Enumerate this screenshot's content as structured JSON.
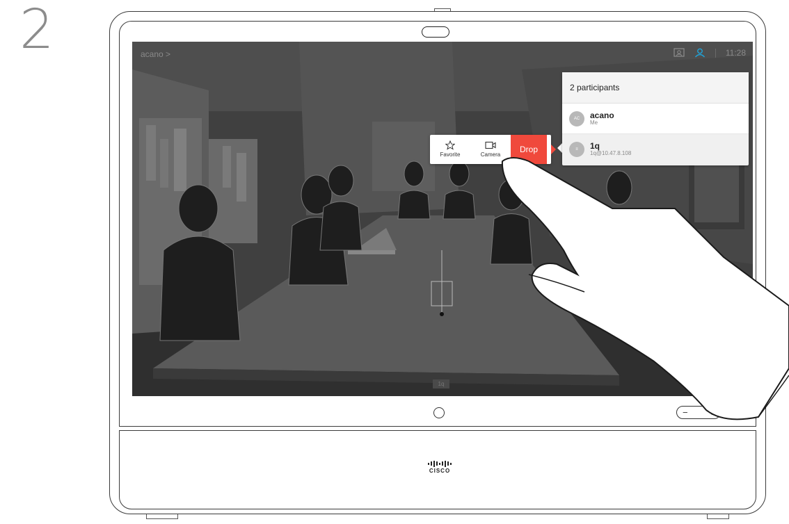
{
  "step": {
    "number": "2"
  },
  "screen": {
    "breadcrumb": "acano >",
    "clock": "11:28",
    "self_view_label": "1q"
  },
  "participants_panel": {
    "header": "2 participants",
    "rows": [
      {
        "initials": "AC",
        "name": "acano",
        "subtitle": "Me"
      },
      {
        "initials": "≡",
        "name": "1q",
        "subtitle": "1q@10.47.8.108"
      }
    ]
  },
  "action_menu": {
    "favorite_label": "Favorite",
    "camera_label": "Camera",
    "drop_label": "Drop",
    "drop_color": "#f0493c"
  },
  "volume": {
    "minus": "−",
    "plus": "+"
  },
  "brand": {
    "name": "CISCO"
  },
  "icons": [
    "star-icon",
    "camera-icon",
    "self-view-icon",
    "participants-icon",
    "home-icon",
    "power-icon",
    "cisco-logo"
  ]
}
